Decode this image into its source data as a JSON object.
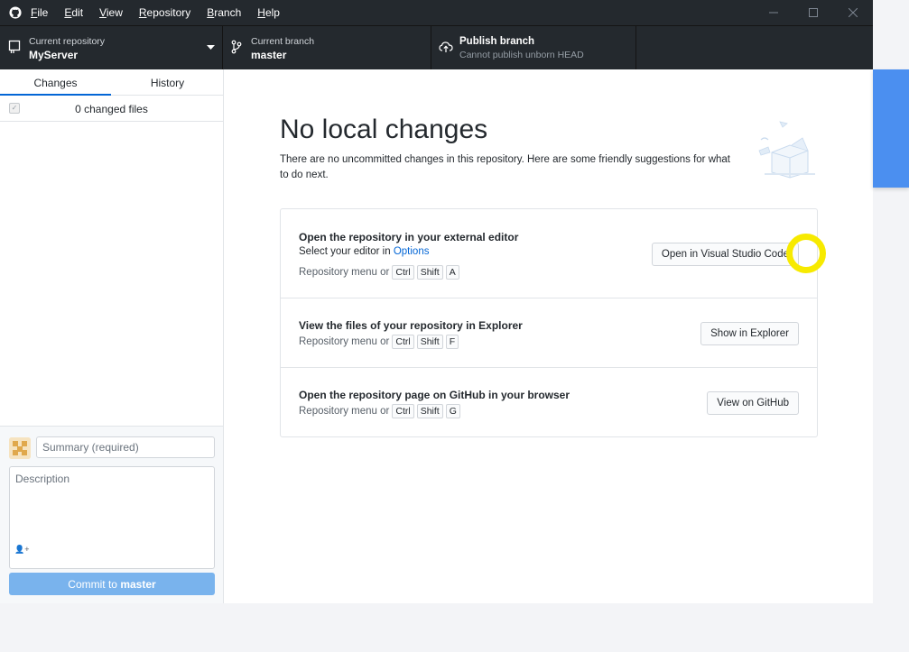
{
  "menu": [
    "File",
    "Edit",
    "View",
    "Repository",
    "Branch",
    "Help"
  ],
  "toolbar": {
    "repo_label": "Current repository",
    "repo_value": "MyServer",
    "branch_label": "Current branch",
    "branch_value": "master",
    "publish_label": "Publish branch",
    "publish_sub": "Cannot publish unborn HEAD"
  },
  "sidebar": {
    "tabs": [
      "Changes",
      "History"
    ],
    "changed_files": "0 changed files",
    "summary_placeholder": "Summary (required)",
    "description_placeholder": "Description",
    "commit_prefix": "Commit to",
    "commit_branch": "master"
  },
  "main": {
    "title": "No local changes",
    "subtitle": "There are no uncommitted changes in this repository. Here are some friendly suggestions for what to do next.",
    "cards": [
      {
        "title": "Open the repository in your external editor",
        "line_prefix": "Select your editor in",
        "line_link": "Options",
        "hint": "Repository menu or",
        "keys": [
          "Ctrl",
          "Shift",
          "A"
        ],
        "button": "Open in Visual Studio Code"
      },
      {
        "title": "View the files of your repository in Explorer",
        "hint": "Repository menu or",
        "keys": [
          "Ctrl",
          "Shift",
          "F"
        ],
        "button": "Show in Explorer"
      },
      {
        "title": "Open the repository page on GitHub in your browser",
        "hint": "Repository menu or",
        "keys": [
          "Ctrl",
          "Shift",
          "G"
        ],
        "button": "View on GitHub"
      }
    ]
  },
  "colors": {
    "dark": "#24292e",
    "accent": "#4b8ff0",
    "commit_button": "#79b3ed",
    "highlight": "#f7ea00",
    "link": "#0366d6"
  }
}
